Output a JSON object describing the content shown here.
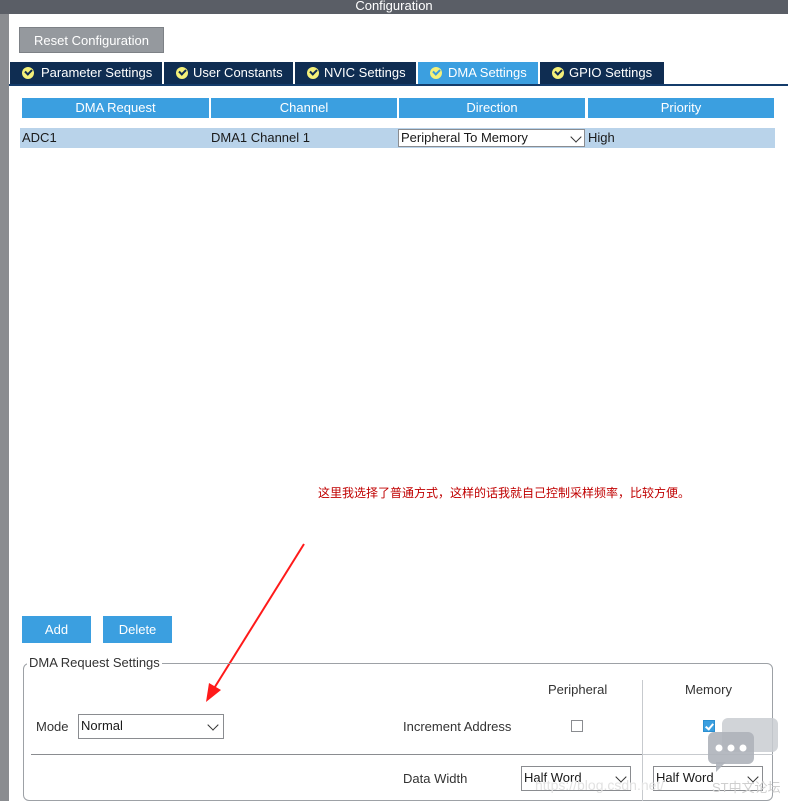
{
  "window": {
    "title": "Configuration"
  },
  "toolbar": {
    "reset_label": "Reset Configuration"
  },
  "tabs": [
    {
      "label": "Parameter Settings",
      "active": false
    },
    {
      "label": "User Constants",
      "active": false
    },
    {
      "label": "NVIC Settings",
      "active": false
    },
    {
      "label": "DMA Settings",
      "active": true
    },
    {
      "label": "GPIO Settings",
      "active": false
    }
  ],
  "table": {
    "headers": [
      "DMA Request",
      "Channel",
      "Direction",
      "Priority"
    ],
    "rows": [
      {
        "request": "ADC1",
        "channel": "DMA1 Channel 1",
        "direction": "Peripheral To Memory",
        "priority": "High"
      }
    ]
  },
  "annotation": {
    "text": "这里我选择了普通方式，这样的话我就自己控制采样频率，比较方便。",
    "color": "#c00000"
  },
  "buttons": {
    "add": "Add",
    "delete": "Delete"
  },
  "settings": {
    "legend": "DMA Request Settings",
    "peripheral_header": "Peripheral",
    "memory_header": "Memory",
    "mode_label": "Mode",
    "mode_value": "Normal",
    "increment_label": "Increment Address",
    "increment_peripheral": false,
    "increment_memory": true,
    "data_width_label": "Data Width",
    "data_width_peripheral": "Half Word",
    "data_width_memory": "Half Word"
  },
  "overlay": {
    "watermark": "https://blog.csdn.net/",
    "badge": "ST中文论坛"
  },
  "colors": {
    "accent": "#3b9fe0",
    "tab_bg": "#0f2d52",
    "row_highlight": "#b9d3ea",
    "annotation": "#c00000"
  }
}
